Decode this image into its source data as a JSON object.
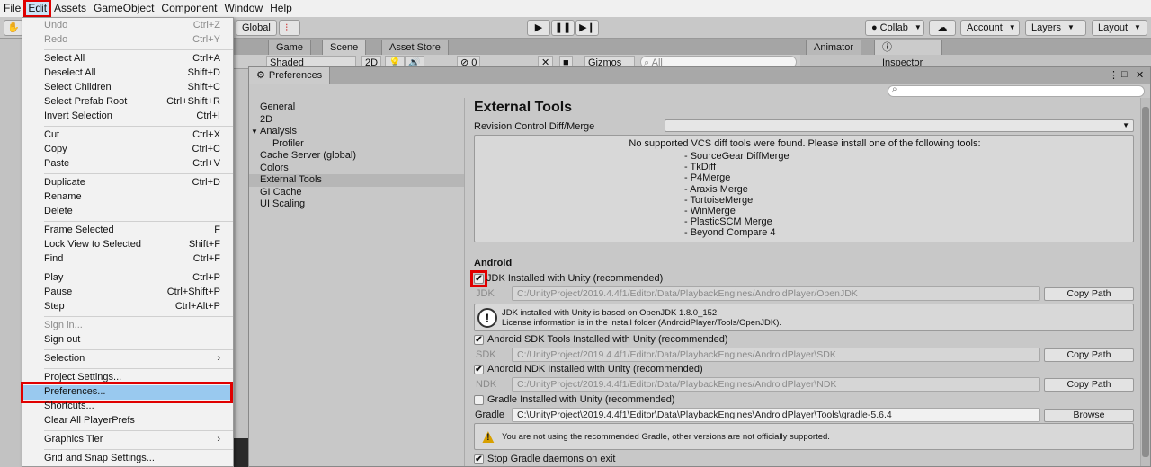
{
  "menubar": {
    "items": [
      "File",
      "Edit",
      "Assets",
      "GameObject",
      "Component",
      "Window",
      "Help"
    ],
    "active": "Edit"
  },
  "toolbar": {
    "global_label": "Global",
    "collab_label": "Collab",
    "account_label": "Account",
    "layers_label": "Layers",
    "layout_label": "Layout"
  },
  "dock": {
    "tabs": [
      "Game",
      "Scene",
      "Asset Store",
      "Animator",
      "Inspector"
    ],
    "scene_bar": {
      "shading": "Shaded",
      "mode_2d": "2D",
      "hidden_count": "0",
      "gizmos": "Gizmos",
      "search_placeholder": "All"
    }
  },
  "preferences": {
    "window_title": "Preferences",
    "nav": [
      {
        "label": "General"
      },
      {
        "label": "2D"
      },
      {
        "label": "Analysis",
        "expanded": true
      },
      {
        "label": "Profiler",
        "sub": true
      },
      {
        "label": "Cache Server (global)"
      },
      {
        "label": "Colors"
      },
      {
        "label": "External Tools",
        "selected": true
      },
      {
        "label": "GI Cache"
      },
      {
        "label": "UI Scaling"
      }
    ],
    "content": {
      "title": "External Tools",
      "revision_label": "Revision Control Diff/Merge",
      "vcs_message": "No supported VCS diff tools were found. Please install one of the following tools:",
      "vcs_tools": [
        "- SourceGear DiffMerge",
        "- TkDiff",
        "- P4Merge",
        "- Araxis Merge",
        "- TortoiseMerge",
        "- WinMerge",
        "- PlasticSCM Merge",
        "- Beyond Compare 4"
      ],
      "android_header": "Android",
      "jdk_checkbox": "JDK Installed with Unity (recommended)",
      "jdk_label": "JDK",
      "jdk_path": "C:/UnityProject/2019.4.4f1/Editor/Data/PlaybackEngines/AndroidPlayer/OpenJDK",
      "copy_path": "Copy Path",
      "jdk_info_line1": "JDK installed with Unity is based on OpenJDK 1.8.0_152.",
      "jdk_info_line2": "License information is in the install folder (AndroidPlayer/Tools/OpenJDK).",
      "sdk_checkbox": "Android SDK Tools Installed with Unity (recommended)",
      "sdk_label": "SDK",
      "sdk_path": "C:/UnityProject/2019.4.4f1/Editor/Data/PlaybackEngines/AndroidPlayer\\SDK",
      "ndk_checkbox": "Android NDK Installed with Unity (recommended)",
      "ndk_label": "NDK",
      "ndk_path": "C:/UnityProject/2019.4.4f1/Editor/Data/PlaybackEngines/AndroidPlayer\\NDK",
      "gradle_checkbox": "Gradle Installed with Unity (recommended)",
      "gradle_label": "Gradle",
      "gradle_path": "C:\\UnityProject\\2019.4.4f1\\Editor\\Data\\PlaybackEngines\\AndroidPlayer\\Tools\\gradle-5.6.4",
      "browse": "Browse",
      "gradle_warning": "You are not using the recommended Gradle, other versions are not officially supported.",
      "stop_gradle_checkbox": "Stop Gradle daemons on exit",
      "checks": {
        "jdk": true,
        "sdk": true,
        "ndk": true,
        "gradle": false,
        "stop_gradle": true
      }
    }
  },
  "edit_menu": {
    "items": [
      {
        "label": "Undo",
        "shortcut": "Ctrl+Z",
        "disabled": true
      },
      {
        "label": "Redo",
        "shortcut": "Ctrl+Y",
        "disabled": true
      },
      {
        "label": "Select All",
        "shortcut": "Ctrl+A"
      },
      {
        "label": "Deselect All",
        "shortcut": "Shift+D"
      },
      {
        "label": "Select Children",
        "shortcut": "Shift+C"
      },
      {
        "label": "Select Prefab Root",
        "shortcut": "Ctrl+Shift+R"
      },
      {
        "label": "Invert Selection",
        "shortcut": "Ctrl+I"
      },
      {
        "label": "Cut",
        "shortcut": "Ctrl+X"
      },
      {
        "label": "Copy",
        "shortcut": "Ctrl+C"
      },
      {
        "label": "Paste",
        "shortcut": "Ctrl+V"
      },
      {
        "label": "Duplicate",
        "shortcut": "Ctrl+D"
      },
      {
        "label": "Rename",
        "shortcut": ""
      },
      {
        "label": "Delete",
        "shortcut": ""
      },
      {
        "label": "Frame Selected",
        "shortcut": "F"
      },
      {
        "label": "Lock View to Selected",
        "shortcut": "Shift+F"
      },
      {
        "label": "Find",
        "shortcut": "Ctrl+F"
      },
      {
        "label": "Play",
        "shortcut": "Ctrl+P"
      },
      {
        "label": "Pause",
        "shortcut": "Ctrl+Shift+P"
      },
      {
        "label": "Step",
        "shortcut": "Ctrl+Alt+P"
      },
      {
        "label": "Sign in...",
        "shortcut": "",
        "disabled": true
      },
      {
        "label": "Sign out",
        "shortcut": ""
      },
      {
        "label": "Selection",
        "shortcut": "›"
      },
      {
        "label": "Project Settings...",
        "shortcut": ""
      },
      {
        "label": "Preferences...",
        "shortcut": "",
        "highlighted": true
      },
      {
        "label": "Shortcuts...",
        "shortcut": ""
      },
      {
        "label": "Clear All PlayerPrefs",
        "shortcut": ""
      },
      {
        "label": "Graphics Tier",
        "shortcut": "›"
      },
      {
        "label": "Grid and Snap Settings...",
        "shortcut": ""
      }
    ]
  }
}
